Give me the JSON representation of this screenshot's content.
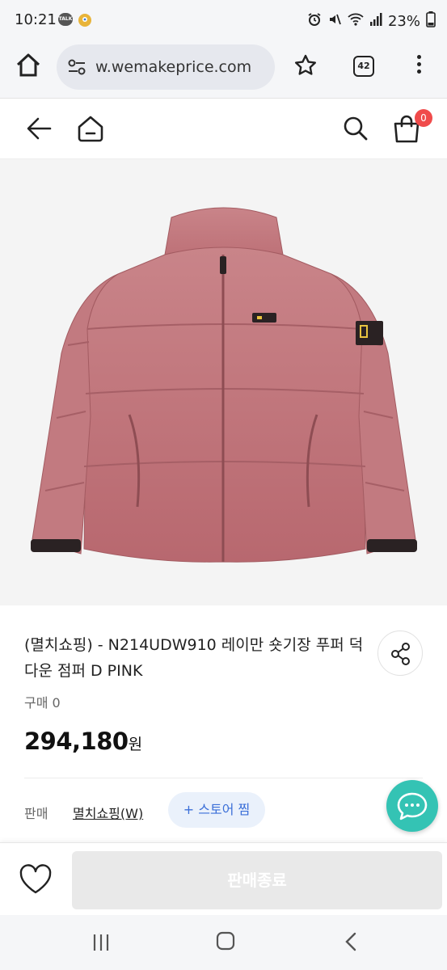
{
  "status_bar": {
    "time": "10:21",
    "talk_icon_label": "TALK",
    "battery": "23%",
    "icons": [
      "talk-icon",
      "location-icon",
      "alarm-icon",
      "mute-icon",
      "wifi-icon",
      "signal-icon",
      "battery-icon"
    ]
  },
  "browser": {
    "url": "w.wemakeprice.com",
    "tab_count": "42",
    "icons": [
      "home-icon",
      "tune-icon",
      "star-icon",
      "tabs-icon",
      "more-icon"
    ]
  },
  "header": {
    "cart_count": "0",
    "icons": [
      "back-arrow-icon",
      "home-icon",
      "search-icon",
      "cart-icon"
    ]
  },
  "product": {
    "image_desc_icon": "pink-puffer-jacket-image",
    "title": "(멸치쇼핑) - N214UDW910 레이만 숏기장 푸퍼 덕 다운 점퍼 D PINK",
    "buy_count": "구매 0",
    "price": "294,180",
    "price_unit": "원",
    "seller_label": "판매",
    "seller_name": "멸치쇼핑(W)",
    "store_follow": "+ 스토어 찜"
  },
  "actions": {
    "sold_out_label": "판매종료"
  },
  "colors": {
    "chat_fab": "#34c3b4",
    "cart_badge": "#f04b4b",
    "follow_text": "#3b6fd8",
    "jacket": "#c47a80"
  }
}
